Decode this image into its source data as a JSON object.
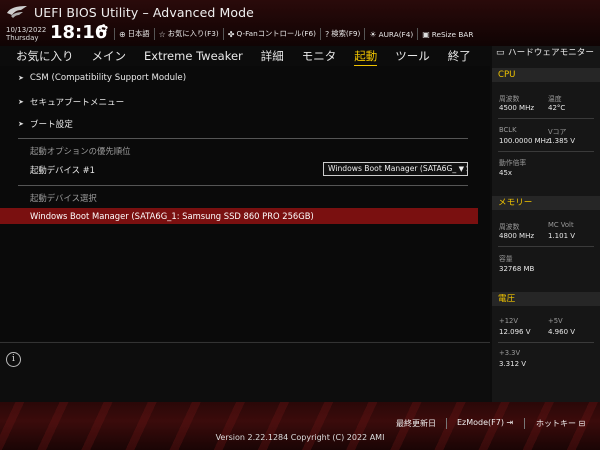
{
  "header": {
    "title": "UEFI BIOS Utility – Advanced Mode",
    "date": "10/13/2022",
    "day": "Thursday",
    "time": "18:16",
    "toolbar": [
      {
        "label": "日本語",
        "icon": "globe-icon"
      },
      {
        "label": "お気に入り(F3)",
        "icon": "star-icon"
      },
      {
        "label": "Q-Fanコントロール(F6)",
        "icon": "fan-icon"
      },
      {
        "label": "検索(F9)",
        "icon": "question-icon"
      },
      {
        "label": "AURA(F4)",
        "icon": "aura-icon"
      },
      {
        "label": "ReSize BAR",
        "icon": "resize-bar-icon"
      }
    ]
  },
  "menu": {
    "items": [
      "お気に入り",
      "メイン",
      "Extreme Tweaker",
      "詳細",
      "モニタ",
      "起動",
      "ツール",
      "終了"
    ],
    "active_index": 5
  },
  "main": {
    "submenus": [
      "CSM (Compatibility Support Module)",
      "セキュアブートメニュー",
      "ブート設定"
    ],
    "boot_priority_section": "起動オプションの優先順位",
    "boot_device_1_label": "起動デバイス #1",
    "boot_device_1_value": "Windows Boot Manager (SATA6G_1: Samsung SSD 860 PRO 256GB)",
    "boot_override_section": "起動デバイス選択",
    "boot_override_item": "Windows Boot Manager (SATA6G_1: Samsung SSD 860 PRO 256GB)"
  },
  "monitor": {
    "title": "ハードウェアモニター",
    "cpu": {
      "heading": "CPU",
      "freq_label": "周波数",
      "freq_value": "4500 MHz",
      "temp_label": "温度",
      "temp_value": "42°C",
      "bclk_label": "BCLK",
      "bclk_value": "100.0000 MHz",
      "vcore_label": "Vコア",
      "vcore_value": "1.385 V",
      "ratio_label": "動作倍率",
      "ratio_value": "45x"
    },
    "memory": {
      "heading": "メモリー",
      "freq_label": "周波数",
      "freq_value": "4800 MHz",
      "volt_label": "MC Volt",
      "volt_value": "1.101 V",
      "cap_label": "容量",
      "cap_value": "32768 MB"
    },
    "voltage": {
      "heading": "電圧",
      "v12_label": "+12V",
      "v12_value": "12.096 V",
      "v5_label": "+5V",
      "v5_value": "4.960 V",
      "v33_label": "+3.3V",
      "v33_value": "3.312 V"
    }
  },
  "footer": {
    "last_modified": "最終更新日",
    "ezmode": "EzMode(F7)",
    "hotkeys": "ホットキー",
    "copyright": "Version 2.22.1284 Copyright (C) 2022 AMI"
  },
  "colors": {
    "accent": "#f0c400",
    "highlight": "#7a1010",
    "header_bg": "#1a0606",
    "panel_bg": "#161616"
  }
}
